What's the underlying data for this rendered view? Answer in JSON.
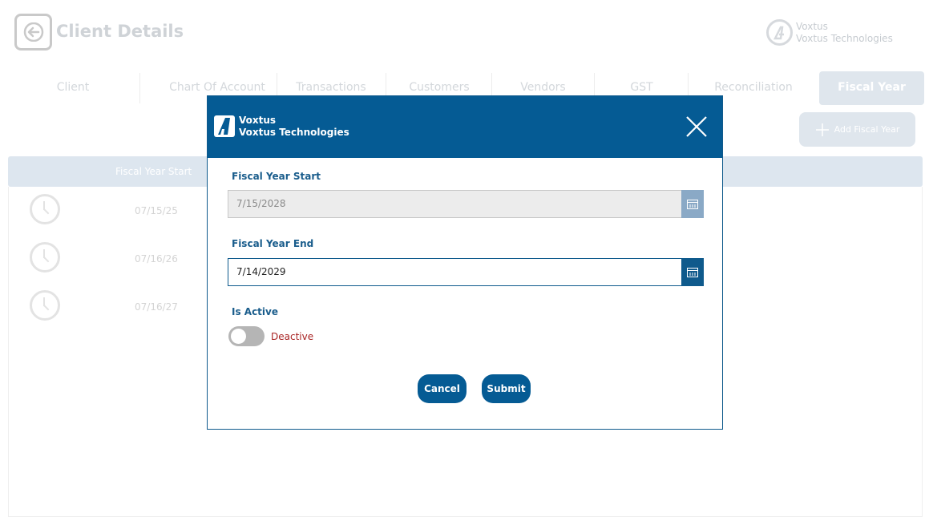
{
  "page": {
    "title": "Client Details",
    "brand": {
      "name": "Voxtus",
      "company": "Voxtus Technologies"
    }
  },
  "tabs": [
    {
      "label": "Client"
    },
    {
      "label": "Chart Of Account"
    },
    {
      "label": "Transactions"
    },
    {
      "label": "Customers"
    },
    {
      "label": "Vendors"
    },
    {
      "label": "GST"
    },
    {
      "label": "Reconciliation"
    },
    {
      "label": "Fiscal Year",
      "active": true
    }
  ],
  "add_fiscal_year_button": "Add Fiscal Year",
  "table": {
    "columns": [
      "Fiscal Year Start"
    ],
    "rows": [
      {
        "start": "07/15/25"
      },
      {
        "start": "07/16/26"
      },
      {
        "start": "07/16/27"
      }
    ]
  },
  "modal": {
    "brand": {
      "name": "Voxtus",
      "company": "Voxtus Technologies"
    },
    "fiscal_year_start": {
      "label": "Fiscal Year Start",
      "value": "7/15/2028"
    },
    "fiscal_year_end": {
      "label": "Fiscal Year End",
      "value": "7/14/2029"
    },
    "is_active": {
      "label": "Is Active",
      "state_text": "Deactive"
    },
    "cancel_label": "Cancel",
    "submit_label": "Submit"
  },
  "colors": {
    "primary": "#055b94",
    "deactive_text": "#a82323",
    "toggle_off": "#b5b5b5"
  },
  "icons": [
    "back-arrow-icon",
    "brand-logo-icon",
    "close-icon",
    "calendar-icon",
    "plus-icon",
    "clock-icon"
  ]
}
